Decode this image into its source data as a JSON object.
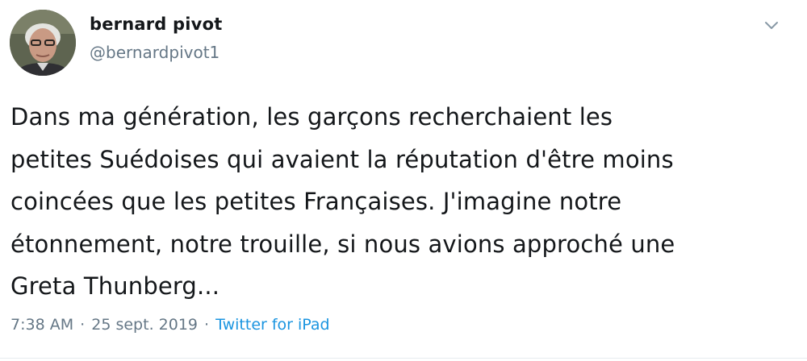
{
  "author": {
    "display_name": "bernard pivot",
    "handle": "@bernardpivot1",
    "avatar_icon": "profile-photo"
  },
  "tweet": {
    "lines": [
      "Dans ma génération, les garçons recherchaient les",
      "petites Suédoises qui avaient la réputation d'être moins",
      "coincées que les petites Françaises. J'imagine notre",
      "étonnement, notre trouille, si nous avions approché une",
      "Greta Thunberg..."
    ]
  },
  "meta": {
    "time": "7:38 AM",
    "separator": "·",
    "date": "25 sept. 2019",
    "source": "Twitter for iPad"
  },
  "icons": {
    "menu": "chevron-down-icon"
  },
  "colors": {
    "text": "#14171a",
    "secondary": "#657786",
    "link": "#1b95e0",
    "background": "#ffffff"
  }
}
